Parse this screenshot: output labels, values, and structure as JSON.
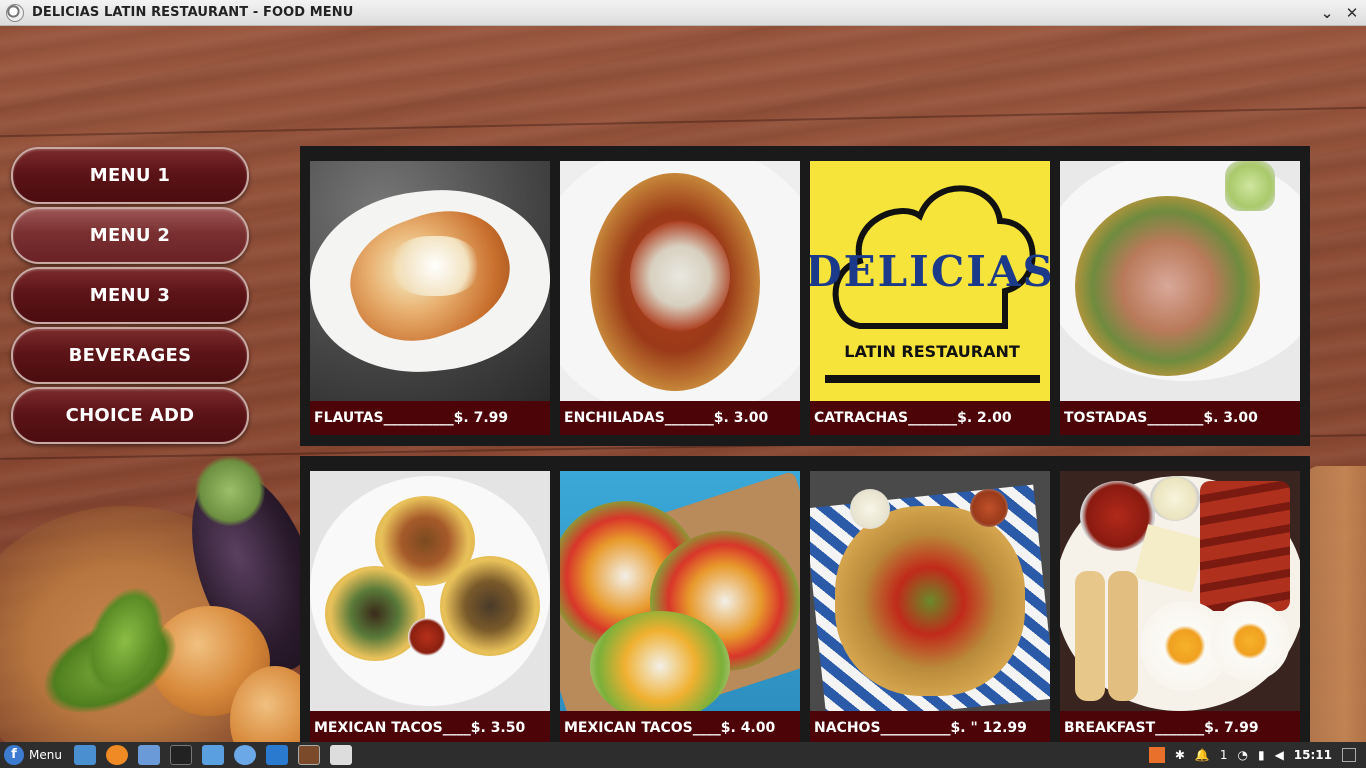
{
  "window": {
    "title": "DELICIAS LATIN RESTAURANT - FOOD MENU"
  },
  "sidebar": {
    "buttons": [
      {
        "label": "MENU 1"
      },
      {
        "label": "MENU 2",
        "active": true
      },
      {
        "label": "MENU 3"
      },
      {
        "label": "BEVERAGES"
      },
      {
        "label": "CHOICE ADD"
      }
    ]
  },
  "menu": {
    "row1": [
      {
        "caption": "FLAUTAS__________$. 7.99",
        "photo": "flautas-plate"
      },
      {
        "caption": "ENCHILADAS_______$. 3.00",
        "photo": "enchilada-tostada"
      },
      {
        "caption": "CATRACHAS_______$. 2.00",
        "photo": "delicias-logo"
      },
      {
        "caption": "TOSTADAS________$. 3.00",
        "photo": "tostada-plate"
      }
    ],
    "row2": [
      {
        "caption": "MEXICAN TACOS____$. 3.50",
        "photo": "tacos-plate"
      },
      {
        "caption": "MEXICAN TACOS____$. 4.00",
        "photo": "tacos-board"
      },
      {
        "caption": "NACHOS__________$. \" 12.99",
        "photo": "nachos-tray"
      },
      {
        "caption": "BREAKFAST_______$. 7.99",
        "photo": "breakfast-plate"
      }
    ]
  },
  "logo": {
    "line1": "DELICIAS",
    "line2": "LATIN RESTAURANT"
  },
  "taskbar": {
    "menu_label": "Menu",
    "notification_count": "1",
    "clock": "15:11"
  },
  "colors": {
    "caption_bg": "#4c0408",
    "button_bg": "#5c1417",
    "logo_bg": "#f7e43a"
  }
}
